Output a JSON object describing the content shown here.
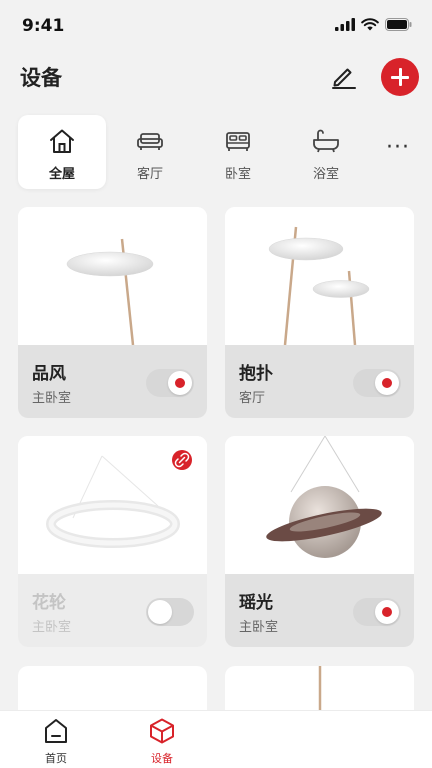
{
  "status_bar": {
    "time": "9:41"
  },
  "header": {
    "title": "设备"
  },
  "rooms": [
    {
      "label": "全屋",
      "icon": "home-icon",
      "active": true
    },
    {
      "label": "客厅",
      "icon": "sofa-icon",
      "active": false
    },
    {
      "label": "卧室",
      "icon": "bed-icon",
      "active": false
    },
    {
      "label": "浴室",
      "icon": "bathtub-icon",
      "active": false
    }
  ],
  "more_label": "···",
  "devices": [
    {
      "name": "品风",
      "room": "主卧室",
      "power": "on",
      "status": "online"
    },
    {
      "name": "抱扑",
      "room": "客厅",
      "power": "on",
      "status": "online"
    },
    {
      "name": "花轮",
      "room": "主卧室",
      "power": "off",
      "status": "offline"
    },
    {
      "name": "瑶光",
      "room": "主卧室",
      "power": "on",
      "status": "online"
    }
  ],
  "tabbar": [
    {
      "label": "首页",
      "icon": "home-tab-icon",
      "active": false
    },
    {
      "label": "设备",
      "icon": "cube-icon",
      "active": true
    }
  ],
  "colors": {
    "accent": "#d8232a",
    "background": "#f2f2f2",
    "card": "#ffffff",
    "card_footer": "#e1e1e1"
  }
}
